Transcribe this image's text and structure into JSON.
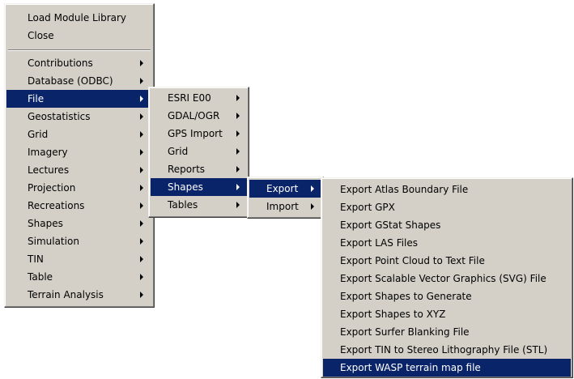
{
  "colors": {
    "menu_bg": "#d4d0c8",
    "highlight_bg": "#0a246a",
    "highlight_text": "#ffffff"
  },
  "main_menu": {
    "top_items": [
      "Load Module Library",
      "Close"
    ],
    "items": [
      "Contributions",
      "Database (ODBC)",
      "File",
      "Geostatistics",
      "Grid",
      "Imagery",
      "Lectures",
      "Projection",
      "Recreations",
      "Shapes",
      "Simulation",
      "TIN",
      "Table",
      "Terrain Analysis"
    ],
    "selected": "File"
  },
  "file_menu": {
    "items": [
      "ESRI E00",
      "GDAL/OGR",
      "GPS Import",
      "Grid",
      "Reports",
      "Shapes",
      "Tables"
    ],
    "selected": "Shapes"
  },
  "shapes_menu": {
    "items": [
      "Export",
      "Import"
    ],
    "selected": "Export"
  },
  "export_menu": {
    "items": [
      "Export Atlas Boundary File",
      "Export GPX",
      "Export GStat Shapes",
      "Export LAS Files",
      "Export Point Cloud to Text File",
      "Export Scalable Vector Graphics (SVG) File",
      "Export Shapes to Generate",
      "Export Shapes to XYZ",
      "Export Surfer Blanking File",
      "Export TIN to Stereo Lithography File (STL)",
      "Export WASP terrain map file"
    ],
    "selected": "Export WASP terrain map file"
  }
}
